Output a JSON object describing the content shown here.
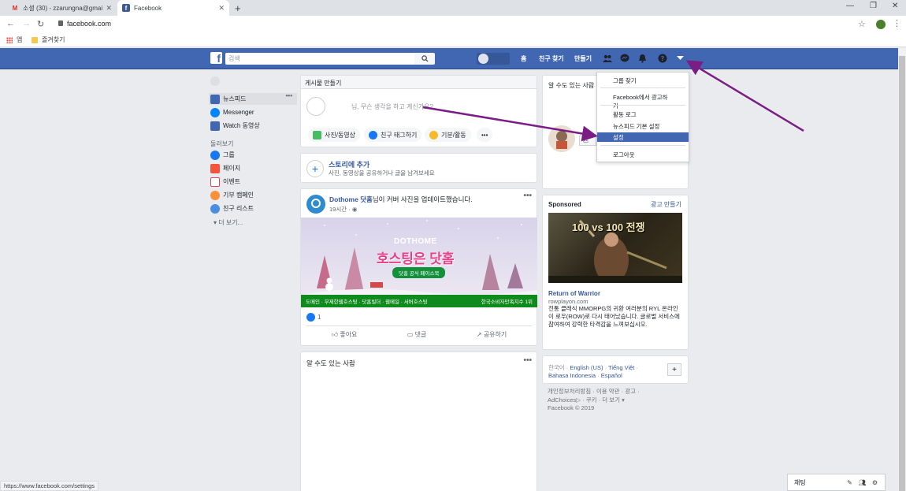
{
  "browser": {
    "tabs": [
      {
        "title": "소셜 (30) - zzarungna@gmail.co",
        "icon": "gmail-icon"
      },
      {
        "title": "Facebook",
        "icon": "facebook-icon"
      }
    ],
    "url": "facebook.com",
    "bookmarks": [
      "앱",
      "즐겨찾기"
    ],
    "status_url": "https://www.facebook.com/settings"
  },
  "fb_header": {
    "search_placeholder": "검색",
    "nav": [
      "홈",
      "친구 찾기",
      "만들기"
    ]
  },
  "left_nav": {
    "items": [
      {
        "label": "뉴스피드",
        "color": "#4267b2"
      },
      {
        "label": "Messenger",
        "color": "#0084ff"
      },
      {
        "label": "Watch 동영상",
        "color": "#4267b2"
      }
    ],
    "section": "둘러보기",
    "explore": [
      {
        "label": "그룹",
        "color": "#1877f2"
      },
      {
        "label": "페이지",
        "color": "#f5533d"
      },
      {
        "label": "이벤트",
        "color": "#e4405f"
      },
      {
        "label": "기부 캠페인",
        "color": "#f7923a"
      },
      {
        "label": "친구 리스트",
        "color": "#4a8de3"
      }
    ],
    "more": "더 보기..."
  },
  "composer": {
    "title": "게시물 만들기",
    "placeholder": "님, 무슨 생각을 하고 계신가요?",
    "buttons": [
      "사진/동영상",
      "친구 태그하기",
      "기분/활동"
    ],
    "more": "•••"
  },
  "story": {
    "title": "스토리에 추가",
    "subtitle": "사진, 동영상을 공유하거나 글을 남겨보세요"
  },
  "post": {
    "author": "Dothome 닷홈",
    "action": "님이 커버 사진을 업데이트했습니다.",
    "time": "19시간 · ",
    "banner_brand": "DOTHOME",
    "banner_title": "호스팅은 닷홈",
    "banner_sub": "닷홈 공식 페이스북",
    "banner_foot_left": "도메인 · 무제한웹호스팅 · 닷홈빌더 · 웹메일 · 서버호스팅",
    "banner_foot_right": "한국소비자만족지수 1위",
    "likes": "1",
    "actions": [
      "좋아요",
      "댓글",
      "공유하기"
    ]
  },
  "pymk": {
    "title": "알 수도 있는 사람"
  },
  "right": {
    "people_title": "알 수도 있는 사람",
    "sponsored": "Sponsored",
    "create_ad": "광고 만들기",
    "ad_image_text": "100 vs 100 전쟁",
    "ad_title": "Return of Warrior",
    "ad_domain": "rowplayon.com",
    "ad_body": "전통 클래식 MMORPG의 귀환 여러분의 RYL 온라인이 로우(ROW)로 다시 태어났습니다. 글로벌 서비스에 참여하여 강력한 타격감을 느껴보십시오.",
    "languages": {
      "current": "한국어",
      "others": [
        "English (US)",
        "Tiếng Việt",
        "Bahasa Indonesia",
        "Español"
      ]
    },
    "footer": [
      "개인정보처리방침",
      "이용 약관",
      "광고",
      "AdChoices",
      "쿠키",
      "더 보기",
      "Facebook © 2019"
    ]
  },
  "dropdown": {
    "items": [
      "그룹 찾기",
      "Facebook에서 광고하기",
      "활동 로그",
      "뉴스피드 기본 설정",
      "설정",
      "로그아웃"
    ]
  },
  "chat": {
    "label": "채팅"
  },
  "colors": {
    "fb_blue": "#4267b2",
    "arrow": "#7a1e86"
  }
}
